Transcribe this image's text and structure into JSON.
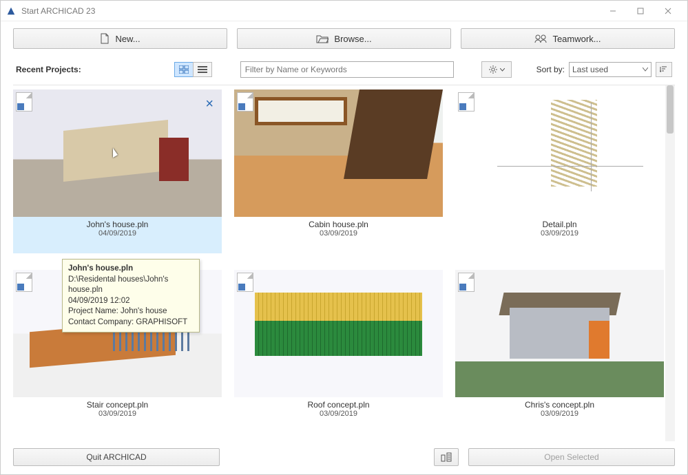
{
  "window": {
    "title": "Start ARCHICAD 23"
  },
  "top": {
    "new": "New...",
    "browse": "Browse...",
    "teamwork": "Teamwork..."
  },
  "toolbar": {
    "recent_label": "Recent Projects:",
    "filter_placeholder": "Filter by Name or Keywords",
    "sort_label": "Sort by:",
    "sort_value": "Last used"
  },
  "projects": [
    {
      "name": "John's house.pln",
      "date": "04/09/2019",
      "selected": true
    },
    {
      "name": "Cabin house.pln",
      "date": "03/09/2019",
      "selected": false
    },
    {
      "name": "Detail.pln",
      "date": "03/09/2019",
      "selected": false
    },
    {
      "name": "Stair concept.pln",
      "date": "03/09/2019",
      "selected": false
    },
    {
      "name": "Roof concept.pln",
      "date": "03/09/2019",
      "selected": false
    },
    {
      "name": "Chris's concept.pln",
      "date": "03/09/2019",
      "selected": false
    }
  ],
  "tooltip": {
    "name": "John's house.pln",
    "path": "D:\\Residental houses\\John's house.pln",
    "datetime": "04/09/2019 12:02",
    "project_label": "Project Name: John's house",
    "company_label": "Contact Company: GRAPHISOFT"
  },
  "footer": {
    "quit": "Quit ARCHICAD",
    "open": "Open Selected"
  }
}
